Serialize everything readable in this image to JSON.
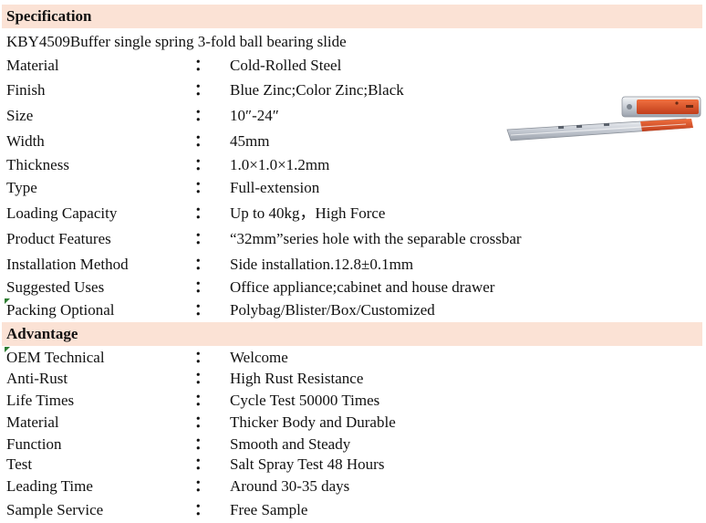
{
  "specification": {
    "title": "Specification",
    "product_line": "KBY4509Buffer single spring 3-fold ball bearing slide",
    "separator": "：",
    "rows": [
      {
        "key": "Material",
        "value": "Cold-Rolled Steel"
      },
      {
        "key": "Finish",
        "value": "Blue Zinc;Color Zinc;Black"
      },
      {
        "key": "Size",
        "value": "10″-24″"
      },
      {
        "key": "Width",
        "value": "45mm"
      },
      {
        "key": "Thickness",
        "value": "1.0×1.0×1.2mm"
      },
      {
        "key": "Type",
        "value": "Full-extension"
      },
      {
        "key": "Loading Capacity",
        "value": "Up to 40kg，High Force"
      },
      {
        "key": "Product Features",
        "value": "“32mm”series hole with the separable crossbar"
      },
      {
        "key": "Installation Method",
        "value": "Side installation.12.8±0.1mm"
      },
      {
        "key": "Suggested Uses",
        "value": "Office appliance;cabinet and house drawer"
      },
      {
        "key": "Packing Optional",
        "value": "Polybag/Blister/Box/Customized"
      }
    ]
  },
  "advantage": {
    "title": "Advantage",
    "rows": [
      {
        "key": "OEM Technical",
        "value": "Welcome"
      },
      {
        "key": "Anti-Rust",
        "value": "High Rust Resistance"
      },
      {
        "key": "Life Times",
        "value": "Cycle Test 50000 Times"
      },
      {
        "key": "Material",
        "value": "Thicker Body and Durable"
      },
      {
        "key": "Function",
        "value": "Smooth and Steady"
      },
      {
        "key": "Test",
        "value": "Salt Spray Test 48 Hours"
      },
      {
        "key": "Leading Time",
        "value": "Around 30-35 days"
      },
      {
        "key": "Sample Service",
        "value": "Free Sample"
      }
    ]
  },
  "colors": {
    "header_background": "#fbe2d5",
    "comment_marker": "#2e7d32",
    "slide_orange": "#d9502a",
    "slide_steel": "#c9ced6"
  },
  "image": {
    "icon": "ball-bearing-slide-photo"
  }
}
